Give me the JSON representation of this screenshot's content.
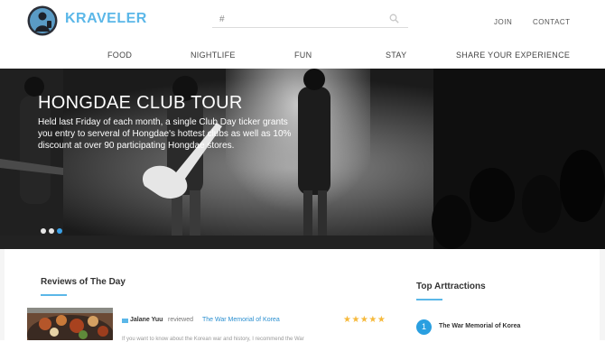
{
  "header": {
    "brand": "KRAVELER",
    "search": {
      "value": "#"
    },
    "links": {
      "join": "JOIN",
      "contact": "CONTACT"
    },
    "nav": [
      "FOOD",
      "NIGHTLIFE",
      "FUN",
      "STAY",
      "SHARE YOUR EXPERIENCE"
    ]
  },
  "hero": {
    "title": "HONGDAE CLUB TOUR",
    "text": "Held last Friday of each month, a single Club Day ticker grants you entry to serveral of Hongdae's hottest clubs as well as 10% discount at over 90 participating Hongdae stores.",
    "slides": {
      "count": 3,
      "active": 3
    }
  },
  "reviews": {
    "title": "Reviews of The Day",
    "items": [
      {
        "reviewer": "Jalane Yuu",
        "action": "reviewed",
        "place": "The War Memorial of Korea",
        "stars": "★★★★★",
        "rating": 5,
        "snippet": "If you want to know about the Korean war and history, I recommend the War"
      }
    ]
  },
  "attractions": {
    "title": "Top Arttractions",
    "items": [
      {
        "rank": "1",
        "name": "The War Memorial of Korea"
      }
    ]
  },
  "colors": {
    "accent": "#5bb7e8",
    "link": "#2a8fd0",
    "star": "#f6b93b"
  }
}
